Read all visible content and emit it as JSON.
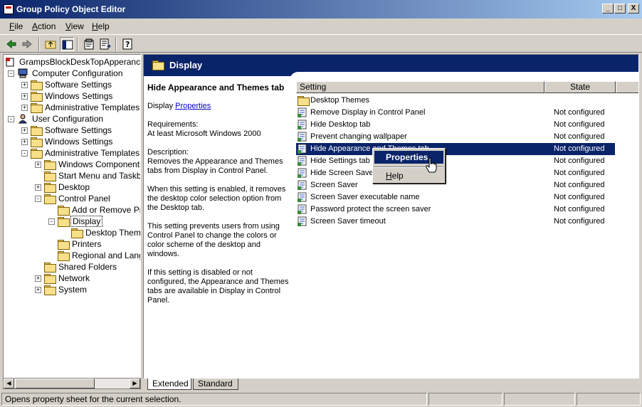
{
  "window": {
    "title": "Group Policy Object Editor",
    "buttons": [
      "_",
      "□",
      "X"
    ]
  },
  "menu": [
    {
      "label": "File",
      "accel": "F",
      "rest": "ile"
    },
    {
      "label": "Action",
      "accel": "A",
      "rest": "ction"
    },
    {
      "label": "View",
      "accel": "V",
      "rest": "iew"
    },
    {
      "label": "Help",
      "accel": "H",
      "rest": "elp"
    }
  ],
  "toolbar": {
    "icons": [
      "back-arrow-icon",
      "forward-arrow-icon",
      "up-one-level-icon",
      "show-hide-tree-icon",
      "properties-icon",
      "export-list-icon",
      "help-icon"
    ]
  },
  "tree": [
    {
      "label": "GrampsBlockDeskTopApperance [BC",
      "level": 0,
      "icon": "policy-icon"
    },
    {
      "label": "Computer Configuration",
      "level": 1,
      "icon": "computer-icon",
      "exp": "-"
    },
    {
      "label": "Software Settings",
      "level": 2,
      "icon": "folder",
      "exp": "+"
    },
    {
      "label": "Windows Settings",
      "level": 2,
      "icon": "folder",
      "exp": "+"
    },
    {
      "label": "Administrative Templates",
      "level": 2,
      "icon": "folder",
      "exp": "+"
    },
    {
      "label": "User Configuration",
      "level": 1,
      "icon": "user-icon",
      "exp": "-"
    },
    {
      "label": "Software Settings",
      "level": 2,
      "icon": "folder",
      "exp": "+"
    },
    {
      "label": "Windows Settings",
      "level": 2,
      "icon": "folder",
      "exp": "+"
    },
    {
      "label": "Administrative Templates",
      "level": 2,
      "icon": "folder",
      "exp": "-"
    },
    {
      "label": "Windows Components",
      "level": 3,
      "icon": "folder",
      "exp": "+"
    },
    {
      "label": "Start Menu and Taskbar",
      "level": 3,
      "icon": "folder",
      "exp": ""
    },
    {
      "label": "Desktop",
      "level": 3,
      "icon": "folder",
      "exp": "+"
    },
    {
      "label": "Control Panel",
      "level": 3,
      "icon": "folder",
      "exp": "-"
    },
    {
      "label": "Add or Remove Pro",
      "level": 4,
      "icon": "folder",
      "exp": ""
    },
    {
      "label": "Display",
      "level": 4,
      "icon": "folder",
      "exp": "-",
      "selected": true
    },
    {
      "label": "Desktop Theme",
      "level": 5,
      "icon": "folder",
      "exp": ""
    },
    {
      "label": "Printers",
      "level": 4,
      "icon": "folder",
      "exp": ""
    },
    {
      "label": "Regional and Langu",
      "level": 4,
      "icon": "folder",
      "exp": ""
    },
    {
      "label": "Shared Folders",
      "level": 3,
      "icon": "folder",
      "exp": ""
    },
    {
      "label": "Network",
      "level": 3,
      "icon": "folder",
      "exp": "+"
    },
    {
      "label": "System",
      "level": 3,
      "icon": "folder",
      "exp": "+"
    }
  ],
  "right": {
    "header": "Display",
    "description": {
      "heading": "Hide Appearance and Themes tab",
      "display_prefix": "Display ",
      "properties_link": "Properties",
      "requirements_label": "Requirements:",
      "requirements": "At least Microsoft Windows 2000",
      "description_label": "Description:",
      "description": "Removes the Appearance and Themes tabs from Display in Control Panel.",
      "enabled": "When this setting is enabled, it removes the desktop color selection option from the Desktop tab.",
      "prevents": "This setting prevents users from using Control Panel to change the colors or color scheme of the desktop and windows.",
      "disabled": "If this setting is disabled or not configured, the Appearance and Themes tabs are available in Display in Control Panel."
    },
    "columns": {
      "setting": "Setting",
      "state": "State"
    },
    "rows": [
      {
        "name": "Desktop Themes",
        "state": "",
        "type": "folder"
      },
      {
        "name": "Remove Display in Control Panel",
        "state": "Not configured",
        "type": "policy"
      },
      {
        "name": "Hide Desktop tab",
        "state": "Not configured",
        "type": "policy"
      },
      {
        "name": "Prevent changing wallpaper",
        "state": "Not configured",
        "type": "policy"
      },
      {
        "name": "Hide Appearance and Themes tab",
        "state": "Not configured",
        "type": "policy",
        "selected": true
      },
      {
        "name": "Hide Settings tab",
        "state": "Not configured",
        "type": "policy"
      },
      {
        "name": "Hide Screen Saver tab",
        "state": "Not configured",
        "type": "policy"
      },
      {
        "name": "Screen Saver",
        "state": "Not configured",
        "type": "policy"
      },
      {
        "name": "Screen Saver executable name",
        "state": "Not configured",
        "type": "policy"
      },
      {
        "name": "Password protect the screen saver",
        "state": "Not configured",
        "type": "policy"
      },
      {
        "name": "Screen Saver timeout",
        "state": "Not configured",
        "type": "policy"
      }
    ],
    "context_menu": {
      "properties": "Properties",
      "help": "Help"
    }
  },
  "tabs": [
    {
      "label": "Extended",
      "active": true
    },
    {
      "label": "Standard",
      "active": false
    }
  ],
  "status": "Opens property sheet for the current selection."
}
